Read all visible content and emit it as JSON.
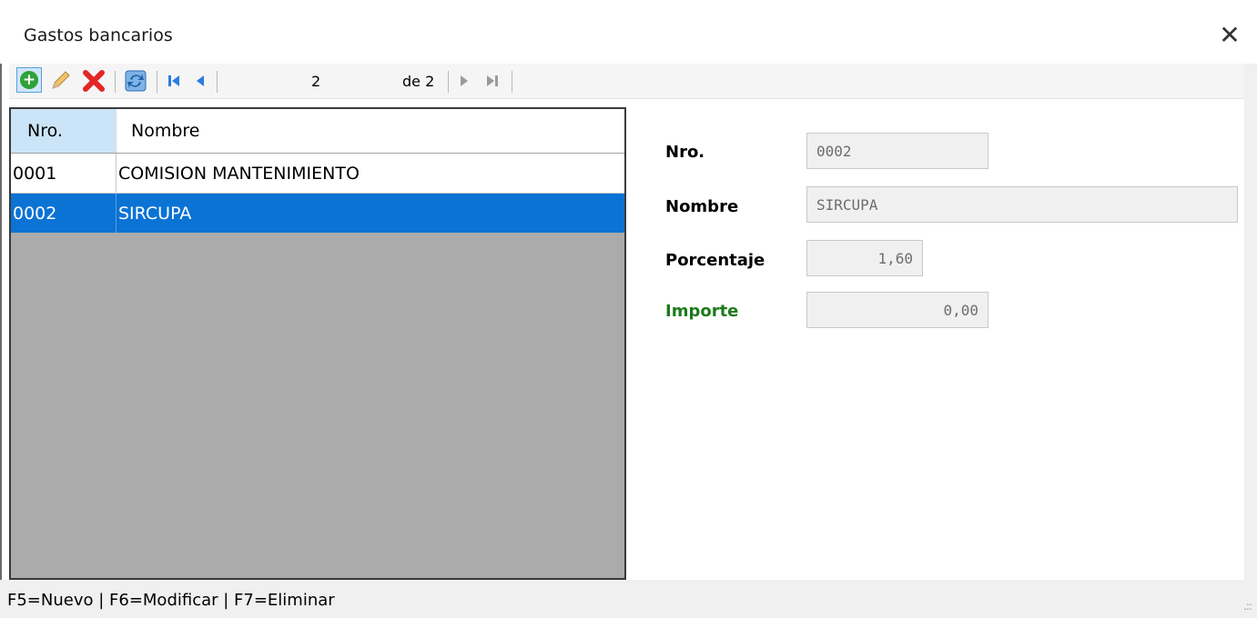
{
  "window": {
    "title": "Gastos bancarios",
    "close_icon": "close-icon"
  },
  "toolbar": {
    "icons": [
      "add-icon",
      "edit-pencil-icon",
      "delete-x-icon",
      "refresh-icon",
      "first-record-icon",
      "previous-record-icon",
      "next-record-icon",
      "last-record-icon"
    ],
    "current_position": "2",
    "total_label": "de 2"
  },
  "grid": {
    "columns": [
      "Nro.",
      "Nombre"
    ],
    "rows": [
      {
        "nro": "0001",
        "nombre": "COMISION MANTENIMIENTO",
        "selected": false
      },
      {
        "nro": "0002",
        "nombre": "SIRCUPA",
        "selected": true
      }
    ]
  },
  "detail": {
    "nro_label": "Nro.",
    "nro_value": "0002",
    "nombre_label": "Nombre",
    "nombre_value": "SIRCUPA",
    "porcentaje_label": "Porcentaje",
    "porcentaje_value": "1,60",
    "importe_label": "Importe",
    "importe_value": "0,00"
  },
  "statusbar": {
    "text": "F5=Nuevo | F6=Modificar | F7=Eliminar"
  },
  "colors": {
    "selection": "#0a73d4",
    "importe_label": "#1c7a1c",
    "grid_empty": "#ababab"
  }
}
